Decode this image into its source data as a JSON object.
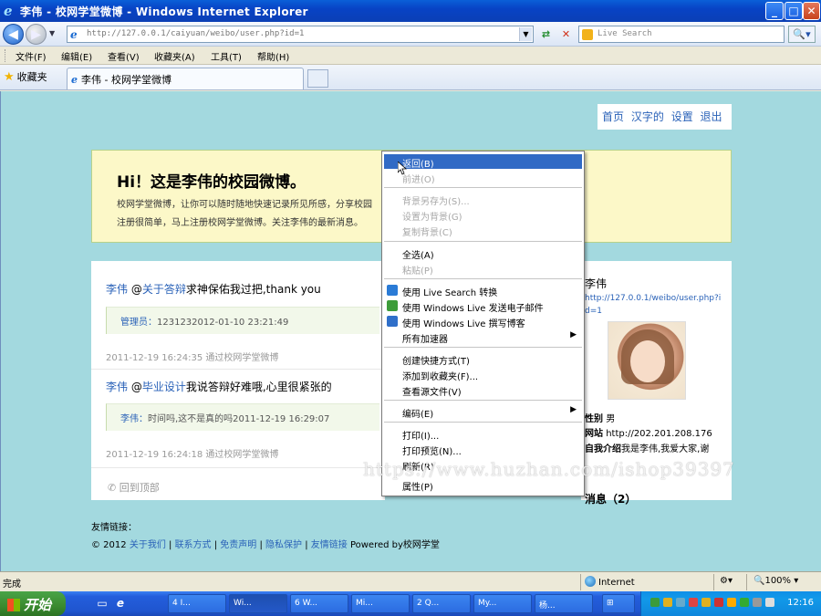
{
  "window": {
    "title": "李伟 - 校网学堂微博 - Windows Internet Explorer",
    "min": "_",
    "max": "□",
    "close": "✕"
  },
  "address": {
    "url": "http://127.0.0.1/caiyuan/weibo/user.php?id=1",
    "search_placeholder": "Live Search"
  },
  "menu": [
    "文件(F)",
    "编辑(E)",
    "查看(V)",
    "收藏夹(A)",
    "工具(T)",
    "帮助(H)"
  ],
  "favorites": {
    "label": "收藏夹",
    "tab_title": "李伟 - 校网学堂微博"
  },
  "site": {
    "nav": [
      "首页",
      "汉字的",
      "设置",
      "退出"
    ],
    "hero_title": "Hi！这是李伟的校园微博。",
    "hero_line1": "校网学堂微博，让你可以随时随地快速记录所见所感，分享校园",
    "hero_line2": "注册很简单，马上注册校网学堂微博。关注李伟的最新消息。",
    "posts": [
      {
        "author": "李伟",
        "at": "@",
        "mention": "关于答辩",
        "text": "求神保佑我过把,thank you",
        "reply_name": "管理员：",
        "reply_text": "1231232012-01-10 23:21:49",
        "meta": "2011-12-19 16:24:35 通过校网学堂微博"
      },
      {
        "author": "李伟",
        "at": "@",
        "mention": "毕业设计",
        "text": "我说答辩好难哦,心里很紧张的",
        "reply_name": "李伟：",
        "reply_text": "时间吗,这不是真的吗2011-12-19 16:29:07",
        "meta": "2011-12-19 16:24:18 通过校网学堂微博"
      }
    ],
    "back_to_top": "回到顶部",
    "sidebar": {
      "name": "李伟",
      "link": "http://127.0.0.1/weibo/user.php?id=1",
      "gender_label": "性别",
      "gender": "男",
      "site_label": "网站",
      "site_url": "http://202.201.208.176",
      "intro_label": "自我介绍",
      "intro": "我是李伟,我爱大家,谢",
      "messages": "消息（2）"
    },
    "footer_label": "友情链接：",
    "footer_copy": "© 2012",
    "footer_links": [
      "关于我们",
      "联系方式",
      "免责声明",
      "隐私保护",
      "友情链接"
    ],
    "footer_powered": "Powered by校网学堂"
  },
  "context_menu": {
    "items": [
      {
        "label": "返回(B)",
        "state": "selected"
      },
      {
        "label": "前进(O)",
        "state": "disabled"
      },
      {
        "label": "背景另存为(S)...",
        "state": "disabled"
      },
      {
        "label": "设置为背景(G)",
        "state": "disabled"
      },
      {
        "label": "复制背景(C)",
        "state": "disabled"
      },
      {
        "label": "全选(A)",
        "state": "normal"
      },
      {
        "label": "粘贴(P)",
        "state": "disabled"
      },
      {
        "label": "使用 Live Search 转换",
        "state": "normal"
      },
      {
        "label": "使用 Windows Live 发送电子邮件",
        "state": "normal"
      },
      {
        "label": "使用 Windows Live 撰写博客",
        "state": "normal"
      },
      {
        "label": "所有加速器",
        "state": "normal"
      },
      {
        "label": "创建快捷方式(T)",
        "state": "normal"
      },
      {
        "label": "添加到收藏夹(F)...",
        "state": "normal"
      },
      {
        "label": "查看源文件(V)",
        "state": "normal"
      },
      {
        "label": "编码(E)",
        "state": "normal"
      },
      {
        "label": "打印(I)...",
        "state": "normal"
      },
      {
        "label": "打印预览(N)...",
        "state": "normal"
      },
      {
        "label": "刷新(R)",
        "state": "normal"
      },
      {
        "label": "属性(P)",
        "state": "normal"
      }
    ],
    "submenu_arrow": "▶"
  },
  "watermark": "https://www.huzhan.com/ishop39397",
  "status": {
    "text": "完成",
    "zone": "Internet",
    "zoom": "100%"
  },
  "taskbar": {
    "start": "开始",
    "tasks": [
      "4 I...",
      "Wi...",
      "6 W...",
      "Mi...",
      "2 Q...",
      "My...",
      "杨..."
    ],
    "clock": "12:16"
  },
  "colors": {
    "page_bg": "#a3d9df",
    "hero_bg": "#fcf8c8",
    "link": "#2a62b8",
    "menu_highlight": "#316ac5"
  }
}
